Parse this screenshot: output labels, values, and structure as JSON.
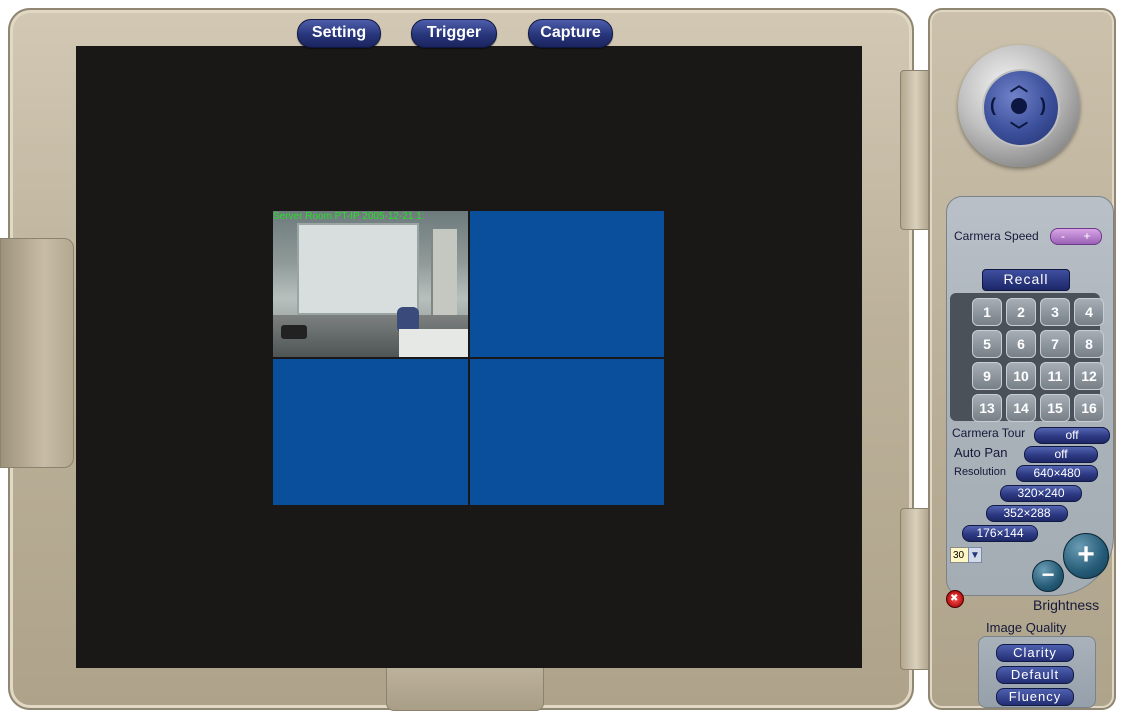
{
  "toolbar": {
    "setting": "Setting",
    "trigger": "Trigger",
    "capture": "Capture"
  },
  "video": {
    "overlay_text": "Server Room PT-IP  2005-12-21  1:"
  },
  "panel": {
    "camera_speed_label": "Carmera Speed",
    "speed_minus": "-",
    "speed_plus": "+",
    "recall": "Recall",
    "presets": [
      "1",
      "2",
      "3",
      "4",
      "5",
      "6",
      "7",
      "8",
      "9",
      "10",
      "11",
      "12",
      "13",
      "14",
      "15",
      "16"
    ],
    "camera_tour_label": "Carmera Tour",
    "camera_tour_value": "off",
    "auto_pan_label": "Auto Pan",
    "auto_pan_value": "off",
    "resolution_label": "Resolution",
    "resolutions": [
      "640×480",
      "320×240",
      "352×288",
      "176×144"
    ],
    "frame_rate": "30",
    "brightness_label": "Brightness",
    "brightness_minus": "−",
    "brightness_plus": "+",
    "image_quality_label": "Image Quality",
    "quality_options": [
      "Clarity",
      "Default",
      "Fluency"
    ]
  },
  "colors": {
    "video_bg": "#1a1816",
    "empty_channel": "#0a4f9b",
    "button_blue": "#27357a",
    "overlay_green": "#26e026"
  }
}
